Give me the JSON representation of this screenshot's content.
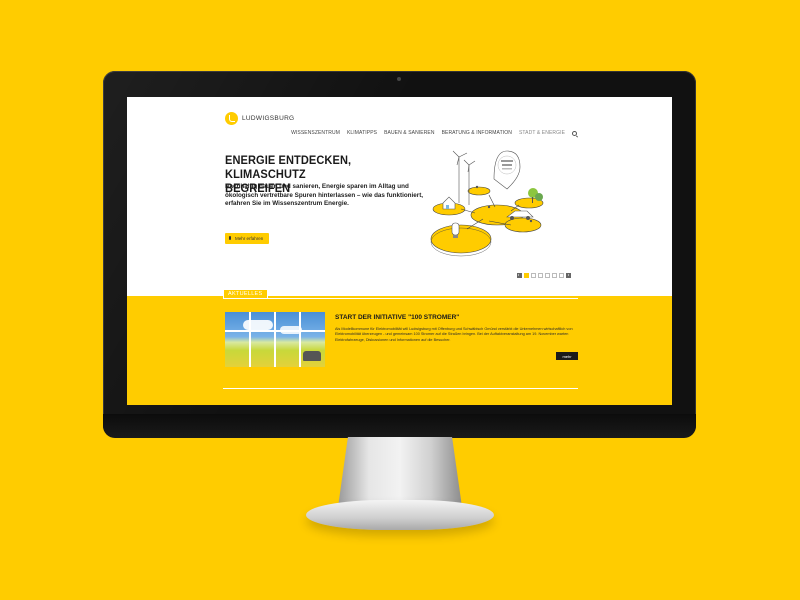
{
  "site": {
    "logo_text": "LUDWIGSBURG"
  },
  "nav": {
    "items": [
      {
        "label": "WISSENSZENTRUM"
      },
      {
        "label": "KLIMATIPPS"
      },
      {
        "label": "BAUEN & SANIEREN"
      },
      {
        "label": "BERATUNG & INFORMATION"
      },
      {
        "label": "STADT & ENERGIE"
      }
    ]
  },
  "hero": {
    "title_line1": "ENERGIE ENTDECKEN,",
    "title_line2": "KLIMASCHUTZ BEGREIFEN",
    "text": "Nachhaltig bauen und sanieren, Energie sparen im Alltag und ökologisch vertretbare Spuren hinterlassen – wie das funktioniert, erfahren Sie im Wissenszentrum Energie.",
    "button_label": "Mehr erfahren",
    "slides_total": 6,
    "slide_active": 1
  },
  "news": {
    "section_label": "AKTUELLES",
    "title": "START DER INITIATIVE \"100 STROMER\"",
    "text": "Als Modellkommune für Elektromobilität will Ludwigsburg mit Offenburg und Schwäbisch Gmünd verstärkt die Unternehmen wirtschaftlich von Elektromobilität überzeugen - und gemeinsam 100 Stromer auf die Straßen bringen. Bei der Auftaktveranstaltung am 19. November warten Elektrofahrzeuge, Diskussionen und Informationen auf die Besucher.",
    "button_label": "mehr"
  },
  "colors": {
    "brand": "#FFCC00",
    "dark": "#1a1a1a"
  }
}
